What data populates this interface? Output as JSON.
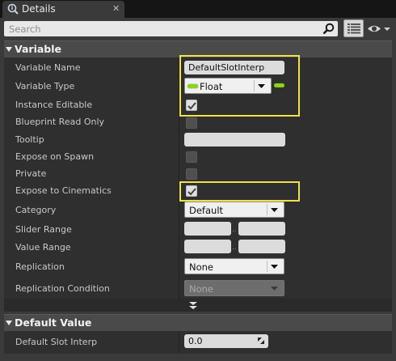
{
  "tab": {
    "title": "Details",
    "close": "✕"
  },
  "search": {
    "placeholder": "Search"
  },
  "variable_section": {
    "title": "Variable",
    "rows": {
      "variable_name": {
        "label": "Variable Name",
        "value": "DefaultSlotInterp"
      },
      "variable_type": {
        "label": "Variable Type",
        "value": "Float"
      },
      "instance_editable": {
        "label": "Instance Editable",
        "checked": true
      },
      "blueprint_read_only": {
        "label": "Blueprint Read Only",
        "checked": false
      },
      "tooltip": {
        "label": "Tooltip",
        "value": ""
      },
      "expose_on_spawn": {
        "label": "Expose on Spawn",
        "checked": false
      },
      "private": {
        "label": "Private",
        "checked": false
      },
      "expose_to_cinematics": {
        "label": "Expose to Cinematics",
        "checked": true
      },
      "category": {
        "label": "Category",
        "value": "Default"
      },
      "slider_range": {
        "label": "Slider Range",
        "min": "",
        "max": ""
      },
      "value_range": {
        "label": "Value Range",
        "min": "",
        "max": ""
      },
      "replication": {
        "label": "Replication",
        "value": "None"
      },
      "replication_condition": {
        "label": "Replication Condition",
        "value": "None"
      }
    }
  },
  "range_separator": "..",
  "default_value_section": {
    "title": "Default Value",
    "rows": {
      "default_slot_interp": {
        "label": "Default Slot Interp",
        "value": "0.0"
      }
    }
  },
  "colors": {
    "highlight": "#f2e14b",
    "float_pin": "#8cd31c",
    "panel_bg": "#3a3a3a",
    "row_bg": "#2f2f2f"
  },
  "icons": [
    "details-icon",
    "search-icon",
    "view-options-icon",
    "visibility-eye-icon",
    "collapse-arrow-icon",
    "checkmark-icon",
    "dropdown-arrow-icon",
    "advanced-expand-icon",
    "value-drag-icon"
  ]
}
